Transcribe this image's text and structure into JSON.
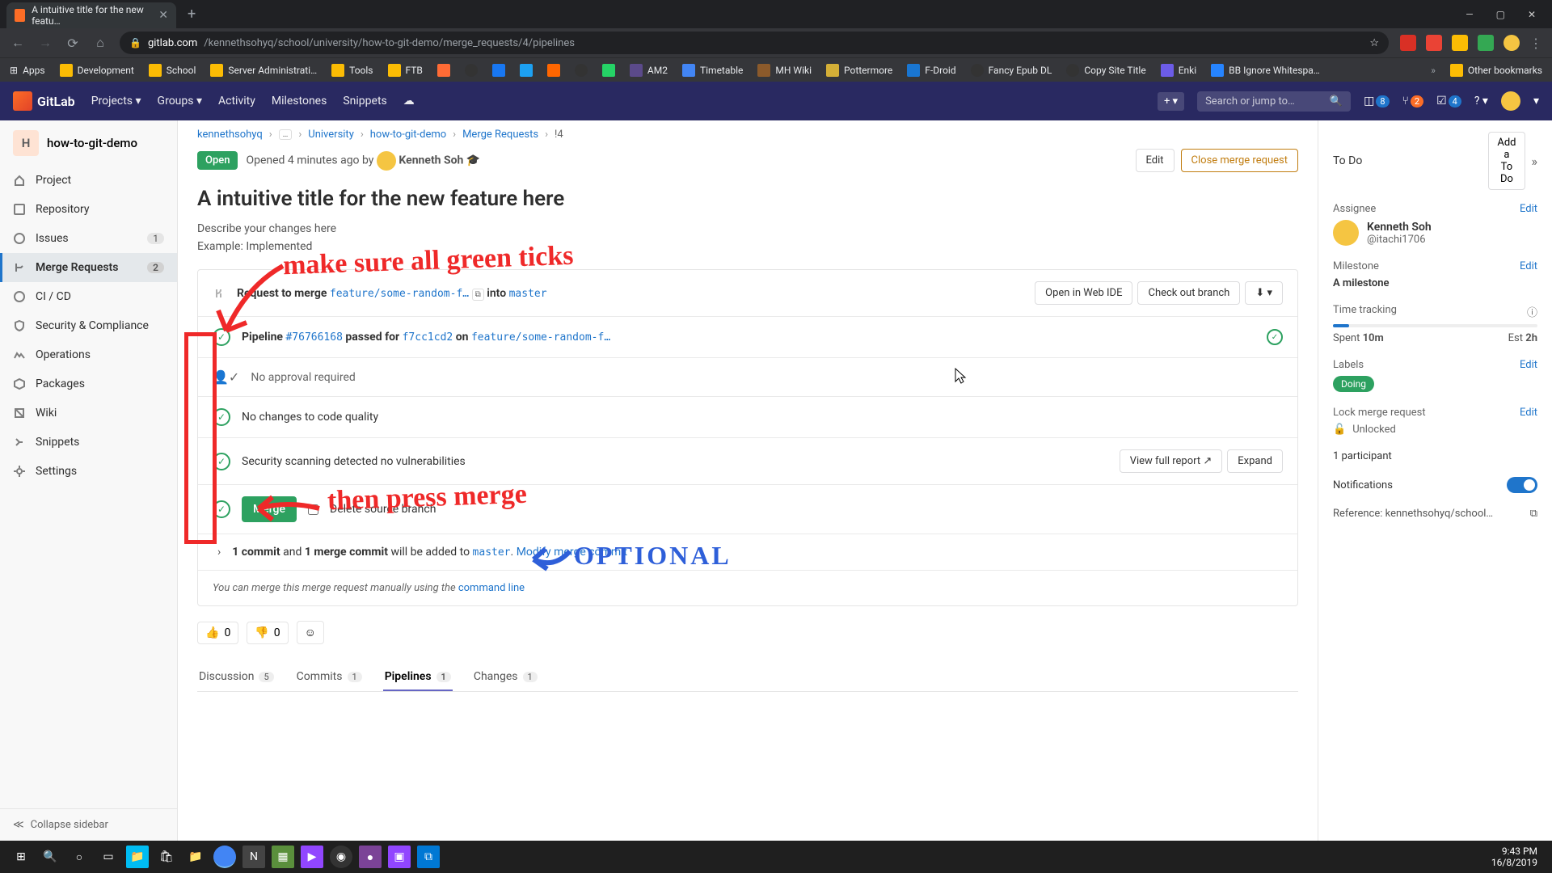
{
  "browser": {
    "tab_title": "A intuitive title for the new featu…",
    "url_host": "gitlab.com",
    "url_path": "/kennethsohyq/school/university/how-to-git-demo/merge_requests/4/pipelines",
    "bookmarks": [
      "Apps",
      "Development",
      "School",
      "Server Administrati…",
      "Tools",
      "FTB",
      "",
      "",
      "",
      "",
      "",
      "AM2",
      "Timetable",
      "MH Wiki",
      "Pottermore",
      "F-Droid",
      "Fancy Epub DL",
      "Copy Site Title",
      "Enki",
      "BB Ignore Whitespa…"
    ],
    "other_bookmarks": "Other bookmarks"
  },
  "gitlab_header": {
    "brand": "GitLab",
    "nav": [
      "Projects",
      "Groups",
      "Activity",
      "Milestones",
      "Snippets"
    ],
    "search_placeholder": "Search or jump to…",
    "plus_label": "+",
    "issues_badge": "8",
    "mr_badge": "2",
    "todo_badge": "4"
  },
  "sidebar": {
    "project_letter": "H",
    "project_name": "how-to-git-demo",
    "items": [
      {
        "icon": "home",
        "label": "Project"
      },
      {
        "icon": "repo",
        "label": "Repository"
      },
      {
        "icon": "issues",
        "label": "Issues",
        "count": "1"
      },
      {
        "icon": "merge",
        "label": "Merge Requests",
        "count": "2",
        "active": true
      },
      {
        "icon": "cicd",
        "label": "CI / CD"
      },
      {
        "icon": "shield",
        "label": "Security & Compliance"
      },
      {
        "icon": "ops",
        "label": "Operations"
      },
      {
        "icon": "pkg",
        "label": "Packages"
      },
      {
        "icon": "wiki",
        "label": "Wiki"
      },
      {
        "icon": "snip",
        "label": "Snippets"
      },
      {
        "icon": "gear",
        "label": "Settings"
      }
    ],
    "collapse": "Collapse sidebar"
  },
  "breadcrumbs": {
    "items": [
      "kennethsohyq",
      "…",
      "University",
      "how-to-git-demo",
      "Merge Requests",
      "!4"
    ]
  },
  "mr": {
    "status": "Open",
    "opened": "Opened 4 minutes ago by",
    "author": "Kenneth Soh",
    "author_badge": "🎓",
    "edit": "Edit",
    "close": "Close merge request",
    "title": "A intuitive title for the new feature here",
    "desc1": "Describe your changes here",
    "desc2": "Example: Implemented"
  },
  "widget": {
    "request_merge": "Request to merge",
    "src_branch": "feature/some-random-f…",
    "into": "into",
    "dst_branch": "master",
    "open_ide": "Open in Web IDE",
    "checkout": "Check out branch",
    "pipeline_label": "Pipeline",
    "pipeline_id": "#76766168",
    "passed_for": "passed for",
    "commit": "f7cc1cd2",
    "on": "on",
    "pipeline_branch": "feature/some-random-f…",
    "no_approval": "No approval required",
    "code_quality": "No changes to code quality",
    "security": "Security scanning detected no vulnerabilities",
    "view_report": "View full report",
    "expand": "Expand",
    "merge_btn": "Merge",
    "delete_src": "Delete source branch",
    "commits_summary_1": "1 commit",
    "commits_and": "and",
    "commits_summary_2": "1 merge commit",
    "commits_tail": "will be added to",
    "commits_branch": "master",
    "modify": "Modify merge commit",
    "manual_merge": "You can merge this merge request manually using the",
    "cmdline": "command line"
  },
  "reactions": {
    "up": "0",
    "down": "0"
  },
  "tabs": {
    "items": [
      {
        "label": "Discussion",
        "count": "5"
      },
      {
        "label": "Commits",
        "count": "1"
      },
      {
        "label": "Pipelines",
        "count": "1",
        "active": true
      },
      {
        "label": "Changes",
        "count": "1"
      }
    ]
  },
  "rightbar": {
    "todo": "To Do",
    "add_todo": "Add a To Do",
    "assignee_label": "Assignee",
    "edit": "Edit",
    "assignee_name": "Kenneth Soh",
    "assignee_handle": "@itachi1706",
    "milestone_label": "Milestone",
    "milestone_value": "A milestone",
    "time_label": "Time tracking",
    "spent_label": "Spent",
    "spent_value": "10m",
    "est_label": "Est",
    "est_value": "2h",
    "labels_label": "Labels",
    "label_value": "Doing",
    "lock_label": "Lock merge request",
    "lock_value": "Unlocked",
    "participants": "1 participant",
    "notifications": "Notifications",
    "reference_label": "Reference:",
    "reference_value": "kennethsohyq/school…"
  },
  "annotations": {
    "text1": "make sure all green ticks",
    "text2": "then press merge",
    "text3": "OPTIONAL"
  },
  "taskbar": {
    "time": "9:43 PM",
    "date": "16/8/2019"
  }
}
